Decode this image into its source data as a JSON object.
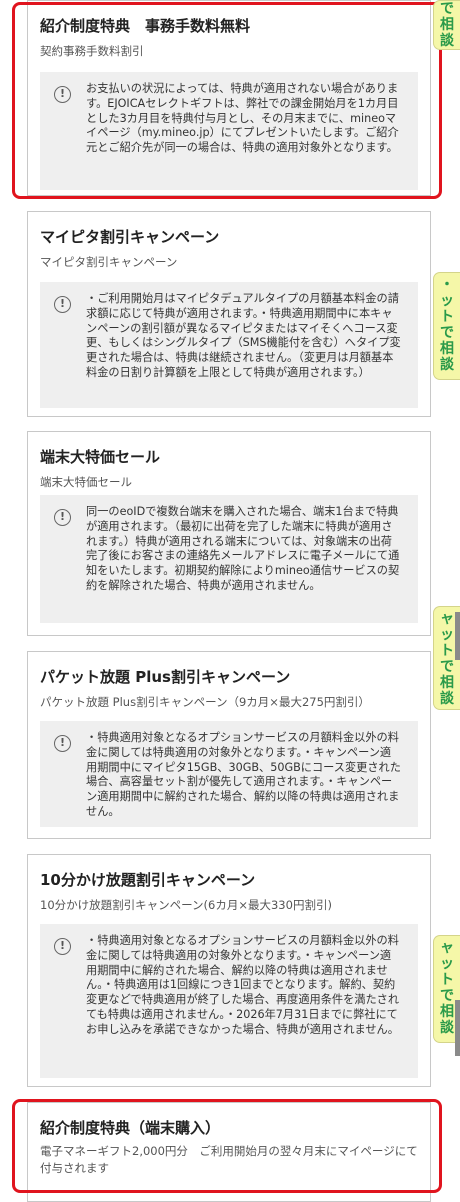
{
  "cards": [
    {
      "title": "紹介制度特典　事務手数料無料",
      "subtitle": "契約事務手数料割引",
      "notice": "お支払いの状況によっては、特典が適用されない場合があります。EJOICAセレクトギフトは、弊社での課金開始月を1カ月目とした3カ月目を特典付与月とし、その月末までに、mineoマイページ（my.mineo.jp）にてプレゼントいたします。ご紹介元とご紹介先が同一の場合は、特典の適用対象外となります。"
    },
    {
      "title": "マイピタ割引キャンペーン",
      "subtitle": "マイピタ割引キャンペーン",
      "notice": "・ご利用開始月はマイピタデュアルタイプの月額基本料金の請求額に応じて特典が適用されます。・特典適用期間中に本キャンペーンの割引額が異なるマイピタまたはマイそくへコース変更、もしくはシングルタイプ（SMS機能付を含む）へタイプ変更された場合は、特典は継続されません。（変更月は月額基本料金の日割り計算額を上限として特典が適用されます。）"
    },
    {
      "title": "端末大特価セール",
      "subtitle": "端末大特価セール",
      "notice": "同一のeoIDで複数台端末を購入された場合、端末1台まで特典が適用されます。（最初に出荷を完了した端末に特典が適用されます。）特典が適用される端末については、対象端末の出荷完了後にお客さまの連絡先メールアドレスに電子メールにて通知をいたします。初期契約解除によりmineo通信サービスの契約を解除された場合、特典が適用されません。"
    },
    {
      "title": "パケット放題 Plus割引キャンペーン",
      "subtitle": "パケット放題 Plus割引キャンペーン（9カ月×最大275円割引）",
      "notice": "・特典適用対象となるオプションサービスの月額料金以外の料金に関しては特典適用の対象外となります。・キャンペーン適用期間中にマイピタ15GB、30GB、50GBにコース変更された場合、高容量セット割が優先して適用されます。・キャンペーン適用期間中に解約された場合、解約以降の特典は適用されません。"
    },
    {
      "title": "10分かけ放題割引キャンペーン",
      "subtitle": "10分かけ放題割引キャンペーン(6カ月×最大330円割引)",
      "notice": "・特典適用対象となるオプションサービスの月額料金以外の料金に関しては特典適用の対象外となります。・キャンペーン適用期間中に解約された場合、解約以降の特典は適用されません。・特典適用は1回線につき1回までとなります。解約、契約変更などで特典適用が終了した場合、再度適用条件を満たされても特典は適用されません。・2026年7月31日までに弊社にてお申し込みを承諾できなかった場合、特典が適用されません。"
    },
    {
      "title": "紹介制度特典（端末購入）",
      "subtitle": "電子マネーギフト2,000円分　ご利用開始月の翌々月末にマイページにて付与されます"
    }
  ],
  "side_tabs": [
    {
      "chars": [
        "で",
        "相",
        "談"
      ]
    },
    {
      "chars": [
        "・",
        "ッ",
        "ト",
        "で",
        "相",
        "談"
      ]
    },
    {
      "chars": [
        "ャ",
        "ッ",
        "ト",
        "で",
        "相",
        "談"
      ]
    },
    {
      "chars": [
        "ャ",
        "ッ",
        "ト",
        "で",
        "相",
        "談"
      ]
    }
  ],
  "info_icon_glyph": "!",
  "colors": {
    "highlight": "#e0141e",
    "chat_tab_bg": "#f5f7a8",
    "chat_tab_text": "#2a9a4a"
  }
}
